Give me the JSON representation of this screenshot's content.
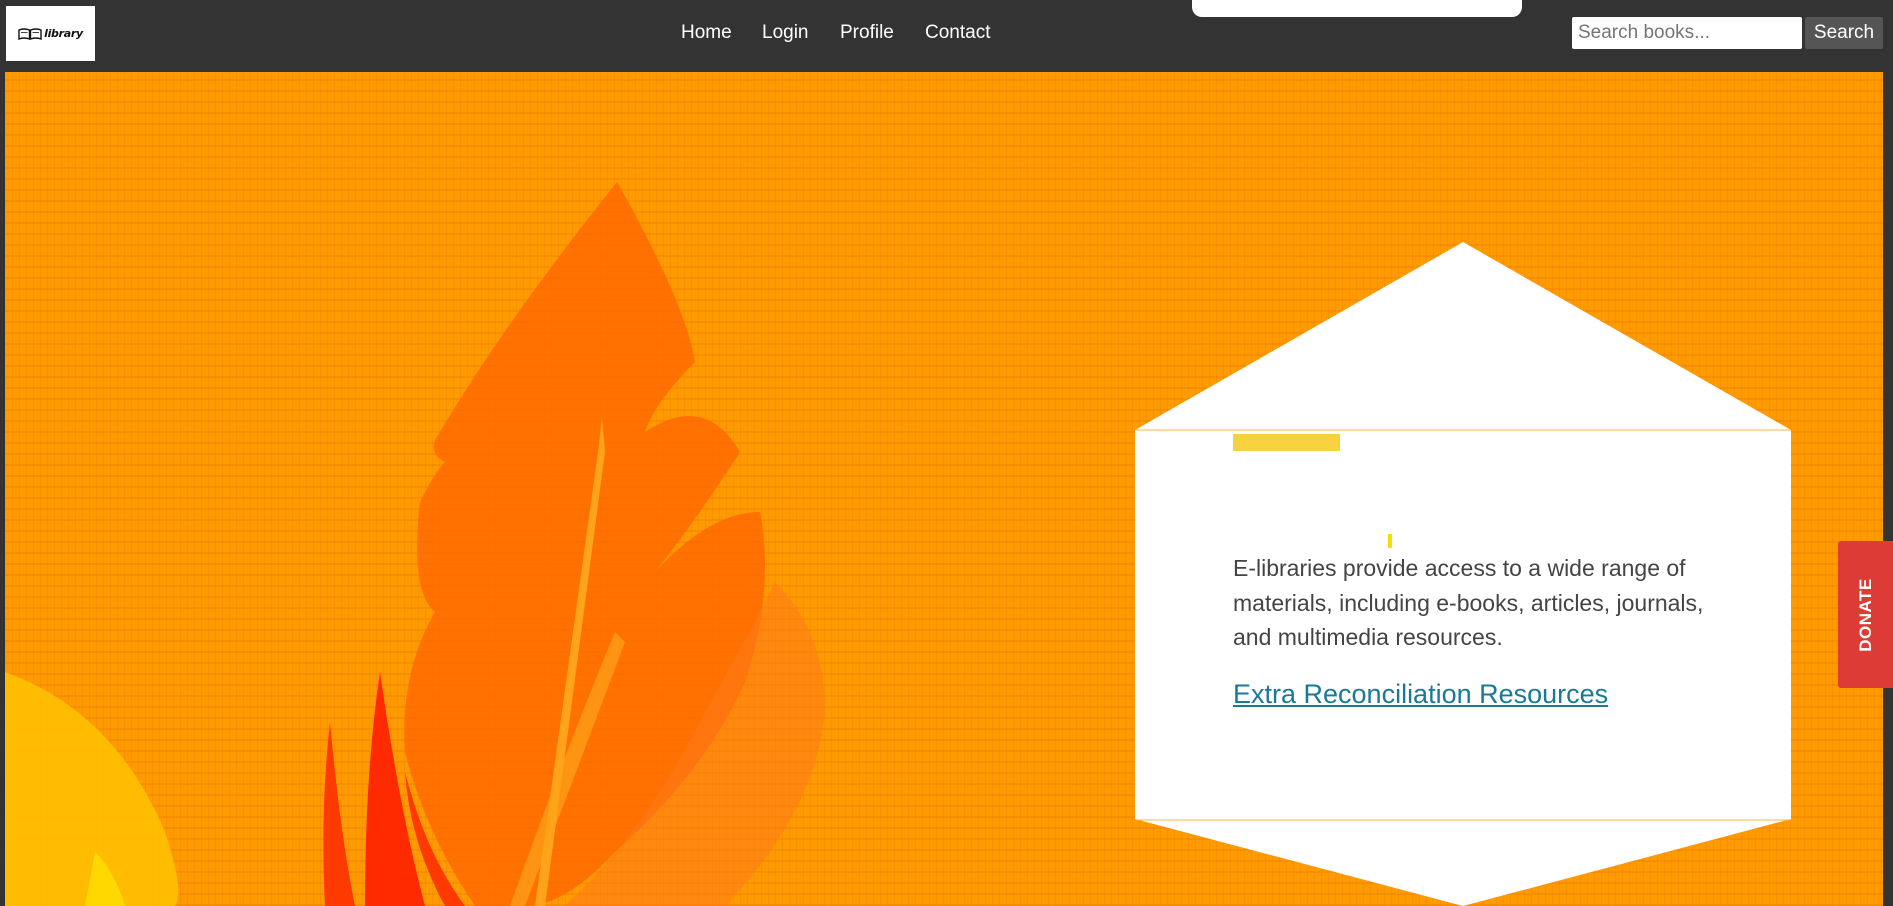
{
  "header": {
    "logo_text": "library",
    "nav": [
      {
        "label": "Home"
      },
      {
        "label": "Login"
      },
      {
        "label": "Profile"
      },
      {
        "label": "Contact"
      }
    ],
    "search": {
      "placeholder": "Search books...",
      "value": "",
      "button_label": "Search"
    }
  },
  "hero": {
    "card": {
      "body_text": "E-libraries provide access to a wide range of materials, including e-books, articles, journals, and multimedia resources.",
      "link_text": "Extra Reconciliation Resources"
    }
  },
  "donate": {
    "label": "DONATE"
  },
  "colors": {
    "header_bg": "#333333",
    "hero_bg": "#ff9a00",
    "link": "#1a7a93",
    "donate_bg": "#dc3b36",
    "accent": "#f7d23e"
  },
  "icons": {
    "logo": "open-book-icon"
  }
}
